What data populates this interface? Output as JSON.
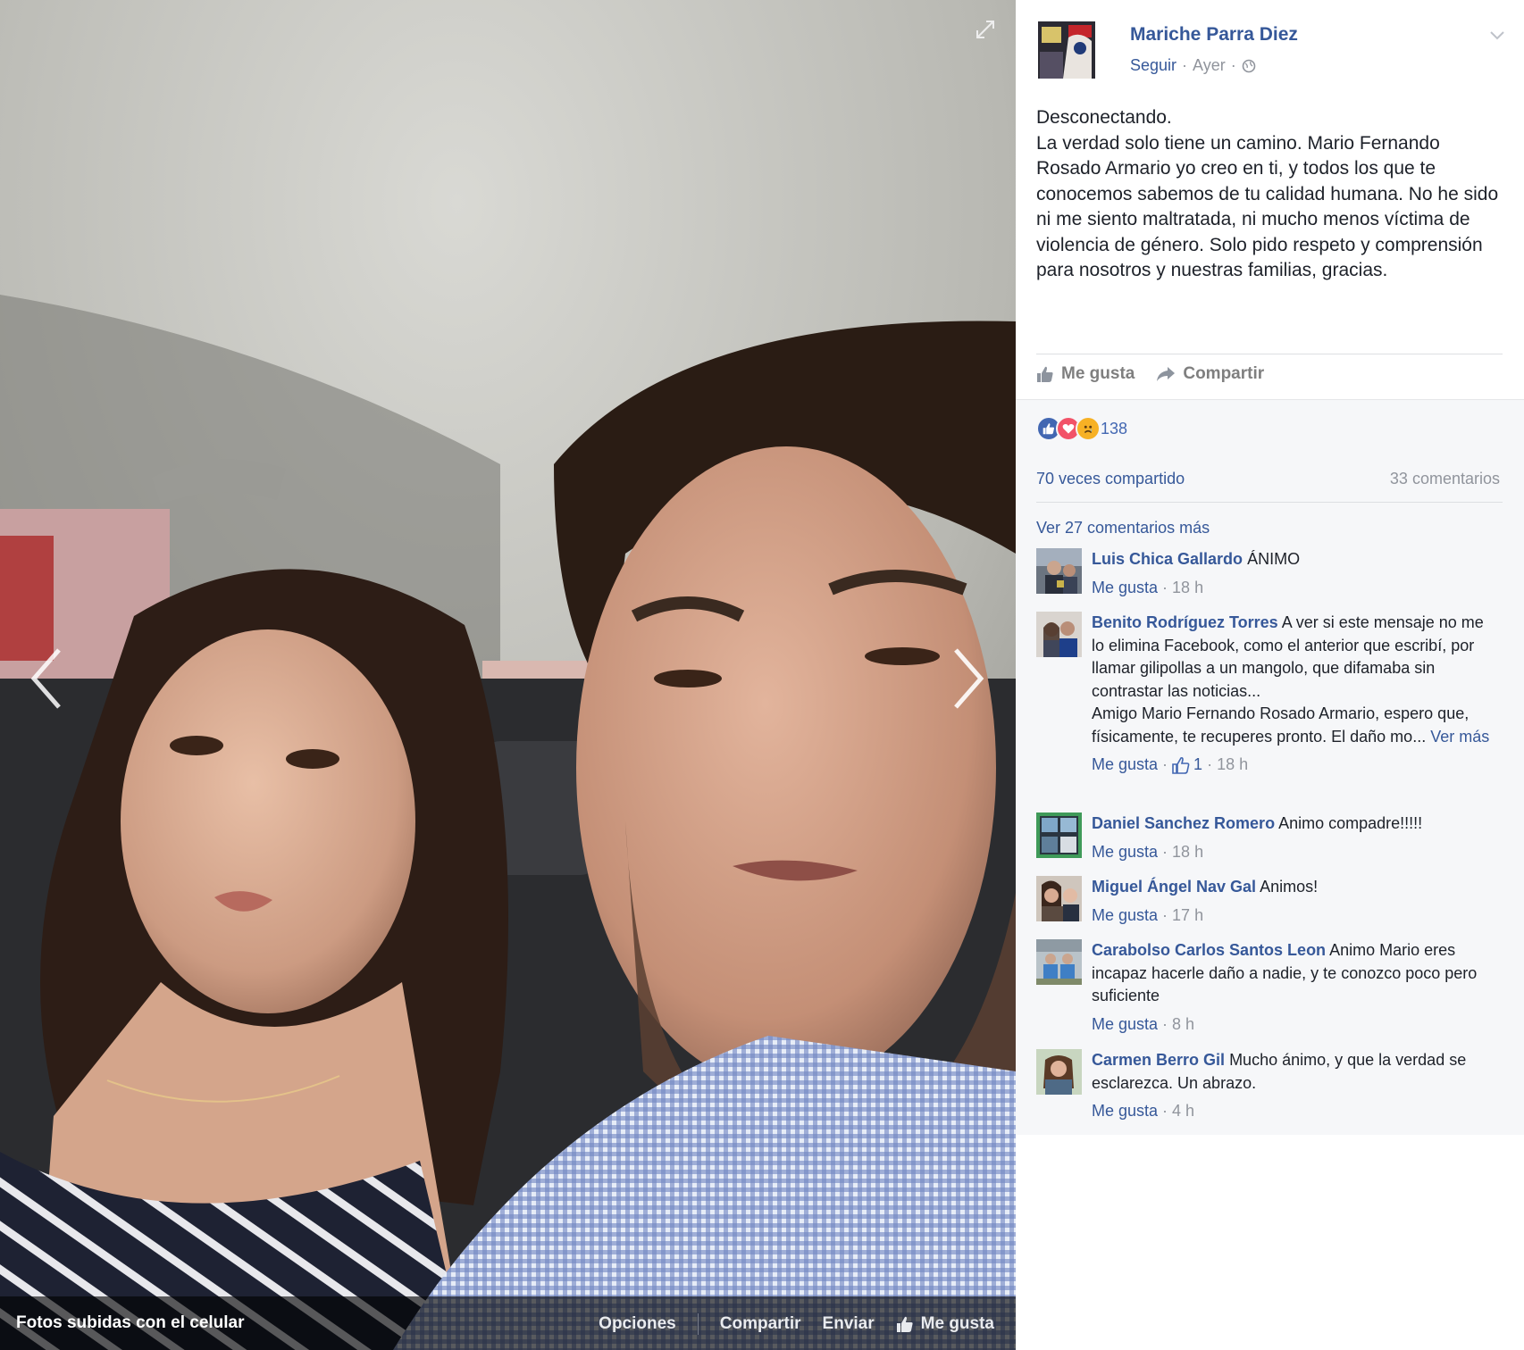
{
  "viewer": {
    "album_label": "Fotos subidas con el celular",
    "actions": {
      "options": "Opciones",
      "share": "Compartir",
      "send": "Enviar",
      "like": "Me gusta"
    }
  },
  "post": {
    "author": "Mariche Parra Diez",
    "follow": "Seguir",
    "time": "Ayer",
    "text": [
      "Desconectando.",
      "La verdad solo tiene un camino. Mario Fernando Rosado Armario yo creo en ti, y todos los que te conocemos sabemos de tu calidad humana. No he sido ni me siento maltratada, ni mucho menos víctima de violencia de género. Solo pido respeto y comprensión para nosotros y nuestras familias, gracias."
    ],
    "like_label": "Me gusta",
    "share_label": "Compartir",
    "reaction_count": "138",
    "shares": "70 veces compartido",
    "comment_count": "33 comentarios",
    "see_more_comments": "Ver 27 comentarios más"
  },
  "comments": [
    {
      "name": "Luis Chica Gallardo",
      "text": "ÁNIMO",
      "like": "Me gusta",
      "time": "18 h"
    },
    {
      "name": "Benito Rodríguez Torres",
      "text": "A ver si este mensaje no me lo elimina Facebook, como el anterior que escribí, por llamar gilipollas a un mangolo, que difamaba sin contrastar las noticias...",
      "text2": "Amigo Mario Fernando Rosado Armario, espero que, físicamente, te recuperes pronto. El daño mo...",
      "see_more": "Ver más",
      "like": "Me gusta",
      "likes": "1",
      "time": "18 h"
    },
    {
      "name": "Daniel Sanchez Romero",
      "text": "Animo compadre!!!!!",
      "like": "Me gusta",
      "time": "18 h"
    },
    {
      "name": "Miguel Ángel Nav Gal",
      "text": "Animos!",
      "like": "Me gusta",
      "time": "17 h"
    },
    {
      "name": "Carabolso Carlos Santos Leon",
      "text": "Animo Mario eres incapaz hacerle daño a nadie, y te conozco poco pero suficiente",
      "like": "Me gusta",
      "time": "8 h"
    },
    {
      "name": "Carmen Berro Gil",
      "text": "Mucho ánimo, y que la verdad se esclarezca. Un abrazo.",
      "like": "Me gusta",
      "time": "4 h"
    }
  ],
  "icons": {
    "expand": "expand-icon",
    "prev": "chevron-left-icon",
    "next": "chevron-right-icon",
    "like": "thumbs-up-icon",
    "share": "share-arrow-icon",
    "globe": "globe-icon",
    "menu": "chevron-down-icon",
    "reactions": [
      "like-reaction-icon",
      "love-reaction-icon",
      "sad-reaction-icon"
    ]
  },
  "colors": {
    "link": "#365899",
    "meta": "#90949c",
    "comments_bg": "#f6f7f9",
    "like_blue": "#4267b2",
    "love_red": "#f25268",
    "sad_yellow": "#f7b125"
  }
}
